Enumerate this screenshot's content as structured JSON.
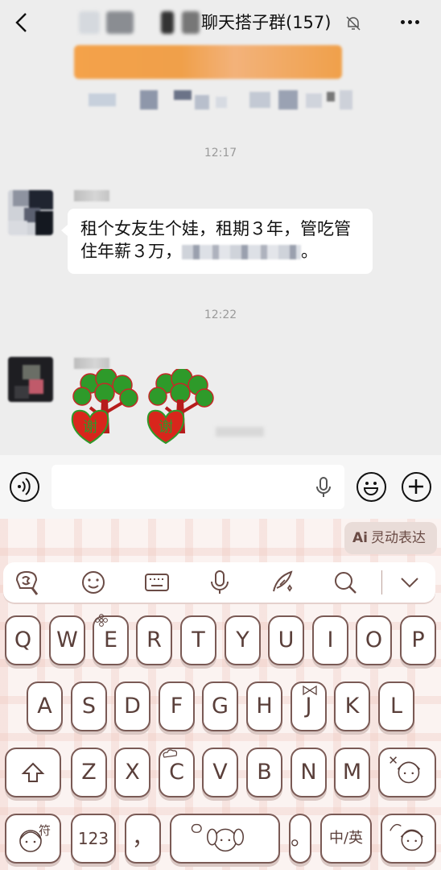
{
  "header": {
    "title": "聊天搭子群(157)"
  },
  "messages": [
    {
      "time": "12:17",
      "text": "租个女友生个娃，租期３年，管吃管住年薪３万，",
      "end_punct": "。"
    },
    {
      "time": "12:22",
      "sticker_text": "谢"
    }
  ],
  "keyboard": {
    "ai_badge": "Ai",
    "ai_label": "灵动表达",
    "row1": [
      "Q",
      "W",
      "E",
      "R",
      "T",
      "Y",
      "U",
      "I",
      "O",
      "P"
    ],
    "row2": [
      "A",
      "S",
      "D",
      "F",
      "G",
      "H",
      "J",
      "K",
      "L"
    ],
    "row3": [
      "Z",
      "X",
      "C",
      "V",
      "B",
      "N",
      "M"
    ],
    "symbols_key": "符",
    "numbers_key": "123",
    "comma_key": "，",
    "period_key": "。",
    "lang_key": "中/英"
  },
  "colors": {
    "chat_bg": "#ededed",
    "key_text": "#5a3f3a",
    "sticker_red": "#d8261c",
    "sticker_green": "#2e9a2a"
  }
}
